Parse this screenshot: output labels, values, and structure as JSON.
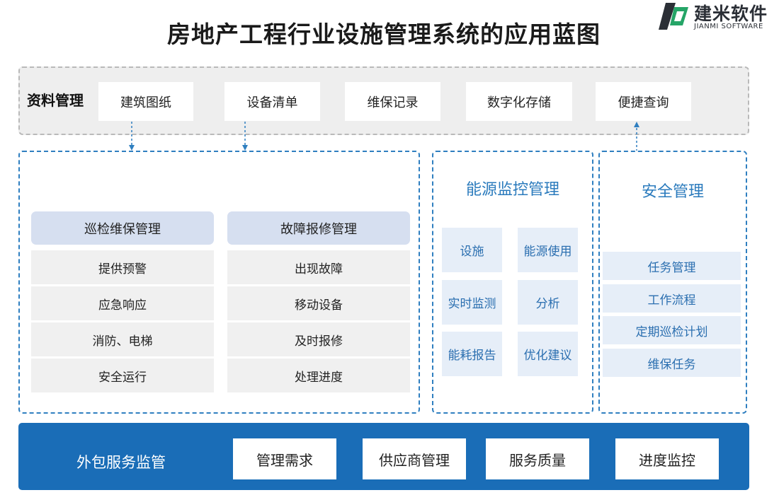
{
  "title": "房地产工程行业设施管理系统的应用蓝图",
  "logo": {
    "cn": "建米软件",
    "en": "JIANMI SOFTWARE"
  },
  "colors": {
    "accent_blue": "#1a6db7",
    "panel_border": "#2f7fc0",
    "head_fill": "#d6dff0",
    "cell_fill": "#e6eef8",
    "cell_text": "#2b6fb0"
  },
  "data_management": {
    "label": "资料管理",
    "items": [
      "建筑图纸",
      "设备清单",
      "维保记录",
      "数字化存储",
      "便捷查询"
    ]
  },
  "maintenance": {
    "inspection": {
      "title": "巡检维保管理",
      "items": [
        "提供预警",
        "应急响应",
        "消防、电梯",
        "安全运行"
      ]
    },
    "repair": {
      "title": "故障报修管理",
      "items": [
        "出现故障",
        "移动设备",
        "及时报修",
        "处理进度"
      ]
    }
  },
  "energy": {
    "title": "能源监控管理",
    "cells": [
      "设施",
      "能源使用",
      "实时监测",
      "分析",
      "能耗报告",
      "优化建议"
    ]
  },
  "safety": {
    "title": "安全管理",
    "items": [
      "任务管理",
      "工作流程",
      "定期巡检计划",
      "维保任务"
    ]
  },
  "outsourcing": {
    "label": "外包服务监管",
    "items": [
      "管理需求",
      "供应商管理",
      "服务质量",
      "进度监控"
    ]
  }
}
